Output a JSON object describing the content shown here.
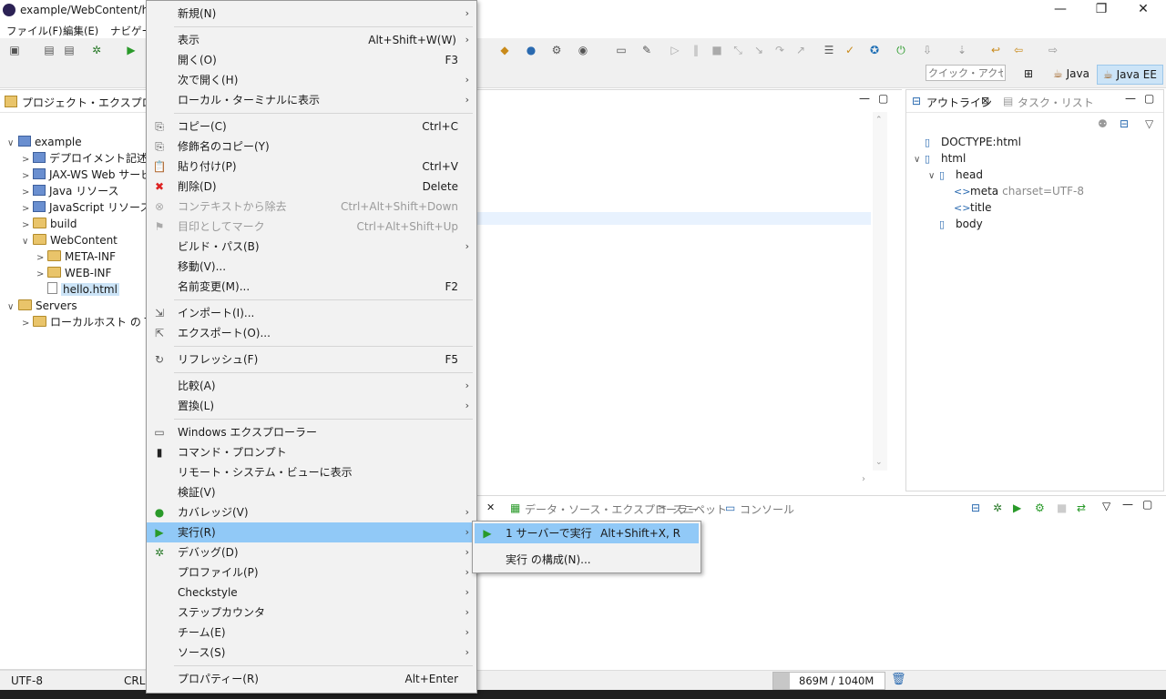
{
  "window": {
    "title": "example/WebContent/hel",
    "controls": {
      "minimize": "—",
      "maximize": "❐",
      "close": "✕"
    }
  },
  "menubar": [
    "ファイル(F)",
    "編集(E)",
    "ナビゲー"
  ],
  "toolbar": {
    "quick_access_placeholder": "クイック・アクセス",
    "perspectives": [
      "Java",
      "Java EE"
    ]
  },
  "project_explorer": {
    "title": "プロジェクト・エクスプローラー",
    "items": [
      {
        "label": "example",
        "depth": 0,
        "toggle": "∨",
        "icon": "project-icon"
      },
      {
        "label": "デプロイメント記述子:",
        "depth": 1,
        "toggle": ">",
        "icon": "descriptor-icon"
      },
      {
        "label": "JAX-WS Web サービ",
        "depth": 1,
        "toggle": ">",
        "icon": "webservice-icon"
      },
      {
        "label": "Java リソース",
        "depth": 1,
        "toggle": ">",
        "icon": "java-resources-icon"
      },
      {
        "label": "JavaScript リソース",
        "depth": 1,
        "toggle": ">",
        "icon": "js-resources-icon"
      },
      {
        "label": "build",
        "depth": 1,
        "toggle": ">",
        "icon": "folder-icon"
      },
      {
        "label": "WebContent",
        "depth": 1,
        "toggle": "∨",
        "icon": "folder-icon"
      },
      {
        "label": "META-INF",
        "depth": 2,
        "toggle": ">",
        "icon": "folder-icon"
      },
      {
        "label": "WEB-INF",
        "depth": 2,
        "toggle": ">",
        "icon": "folder-icon"
      },
      {
        "label": "hello.html",
        "depth": 2,
        "toggle": "",
        "icon": "html-file-icon",
        "selected": true
      },
      {
        "label": "Servers",
        "depth": 0,
        "toggle": "∨",
        "icon": "folder-icon"
      },
      {
        "label": "ローカルホスト の Tom",
        "depth": 1,
        "toggle": ">",
        "icon": "folder-icon"
      }
    ]
  },
  "outline": {
    "tabs": [
      "アウトライン",
      "タスク・リスト"
    ],
    "items": [
      {
        "label": "DOCTYPE:html",
        "depth": 0,
        "toggle": "",
        "extra": ""
      },
      {
        "label": "html",
        "depth": 0,
        "toggle": "∨",
        "extra": ""
      },
      {
        "label": "head",
        "depth": 1,
        "toggle": "∨",
        "extra": ""
      },
      {
        "label": "meta",
        "depth": 2,
        "toggle": "",
        "extra": "charset=UTF-8"
      },
      {
        "label": "title",
        "depth": 2,
        "toggle": "",
        "extra": ""
      },
      {
        "label": "body",
        "depth": 1,
        "toggle": "",
        "extra": ""
      }
    ]
  },
  "bottom_tabs": [
    "データ・ソース・エクスプローラー",
    "スニペット",
    "コンソール"
  ],
  "context_menu": {
    "items": [
      {
        "label": "新規(N)",
        "accel": "",
        "submenu": true,
        "icon": ""
      },
      {
        "sep": true
      },
      {
        "label": "表示",
        "accel": "Alt+Shift+W(W)",
        "submenu": true,
        "icon": ""
      },
      {
        "label": "開く(O)",
        "accel": "F3",
        "submenu": false,
        "icon": ""
      },
      {
        "label": "次で開く(H)",
        "accel": "",
        "submenu": true,
        "icon": ""
      },
      {
        "label": "ローカル・ターミナルに表示",
        "accel": "",
        "submenu": true,
        "icon": ""
      },
      {
        "sep": true
      },
      {
        "label": "コピー(C)",
        "accel": "Ctrl+C",
        "submenu": false,
        "icon": "copy-icon"
      },
      {
        "label": "修飾名のコピー(Y)",
        "accel": "",
        "submenu": false,
        "icon": "copy-qualified-icon"
      },
      {
        "label": "貼り付け(P)",
        "accel": "Ctrl+V",
        "submenu": false,
        "icon": "paste-icon"
      },
      {
        "label": "削除(D)",
        "accel": "Delete",
        "submenu": false,
        "icon": "delete-icon"
      },
      {
        "label": "コンテキストから除去",
        "accel": "Ctrl+Alt+Shift+Down",
        "submenu": false,
        "icon": "remove-context-icon",
        "disabled": true
      },
      {
        "label": "目印としてマーク",
        "accel": "Ctrl+Alt+Shift+Up",
        "submenu": false,
        "icon": "mark-icon",
        "disabled": true
      },
      {
        "label": "ビルド・パス(B)",
        "accel": "",
        "submenu": true,
        "icon": ""
      },
      {
        "label": "移動(V)...",
        "accel": "",
        "submenu": false,
        "icon": ""
      },
      {
        "label": "名前変更(M)...",
        "accel": "F2",
        "submenu": false,
        "icon": ""
      },
      {
        "sep": true
      },
      {
        "label": "インポート(I)...",
        "accel": "",
        "submenu": false,
        "icon": "import-icon"
      },
      {
        "label": "エクスポート(O)...",
        "accel": "",
        "submenu": false,
        "icon": "export-icon"
      },
      {
        "sep": true
      },
      {
        "label": "リフレッシュ(F)",
        "accel": "F5",
        "submenu": false,
        "icon": "refresh-icon"
      },
      {
        "sep": true
      },
      {
        "label": "比較(A)",
        "accel": "",
        "submenu": true,
        "icon": ""
      },
      {
        "label": "置換(L)",
        "accel": "",
        "submenu": true,
        "icon": ""
      },
      {
        "sep": true
      },
      {
        "label": "Windows エクスプローラー",
        "accel": "",
        "submenu": false,
        "icon": "windows-explorer-icon"
      },
      {
        "label": "コマンド・プロンプト",
        "accel": "",
        "submenu": false,
        "icon": "command-prompt-icon"
      },
      {
        "label": "リモート・システム・ビューに表示",
        "accel": "",
        "submenu": false,
        "icon": ""
      },
      {
        "label": "検証(V)",
        "accel": "",
        "submenu": false,
        "icon": ""
      },
      {
        "label": "カバレッジ(V)",
        "accel": "",
        "submenu": true,
        "icon": "coverage-icon"
      },
      {
        "label": "実行(R)",
        "accel": "",
        "submenu": true,
        "icon": "run-icon",
        "highlighted": true
      },
      {
        "label": "デバッグ(D)",
        "accel": "",
        "submenu": true,
        "icon": "debug-icon"
      },
      {
        "label": "プロファイル(P)",
        "accel": "",
        "submenu": true,
        "icon": ""
      },
      {
        "label": "Checkstyle",
        "accel": "",
        "submenu": true,
        "icon": ""
      },
      {
        "label": "ステップカウンタ",
        "accel": "",
        "submenu": true,
        "icon": ""
      },
      {
        "label": "チーム(E)",
        "accel": "",
        "submenu": true,
        "icon": ""
      },
      {
        "label": "ソース(S)",
        "accel": "",
        "submenu": true,
        "icon": ""
      },
      {
        "sep": true
      },
      {
        "label": "プロパティー(R)",
        "accel": "Alt+Enter",
        "submenu": false,
        "icon": ""
      }
    ]
  },
  "run_submenu": [
    {
      "label": "1 サーバーで実行",
      "accel": "Alt+Shift+X, R",
      "highlighted": true
    },
    {
      "label": "実行 の構成(N)...",
      "accel": "",
      "highlighted": false
    }
  ],
  "statusbar": {
    "encoding": "UTF-8",
    "line_ending": "CRLF",
    "heap": "869M / 1040M",
    "heap_used_fraction": 0.8356
  },
  "colors": {
    "menu_highlight": "#91c9f7",
    "selection": "#cce4f7",
    "toolbar_bg": "#f0f0f0"
  }
}
